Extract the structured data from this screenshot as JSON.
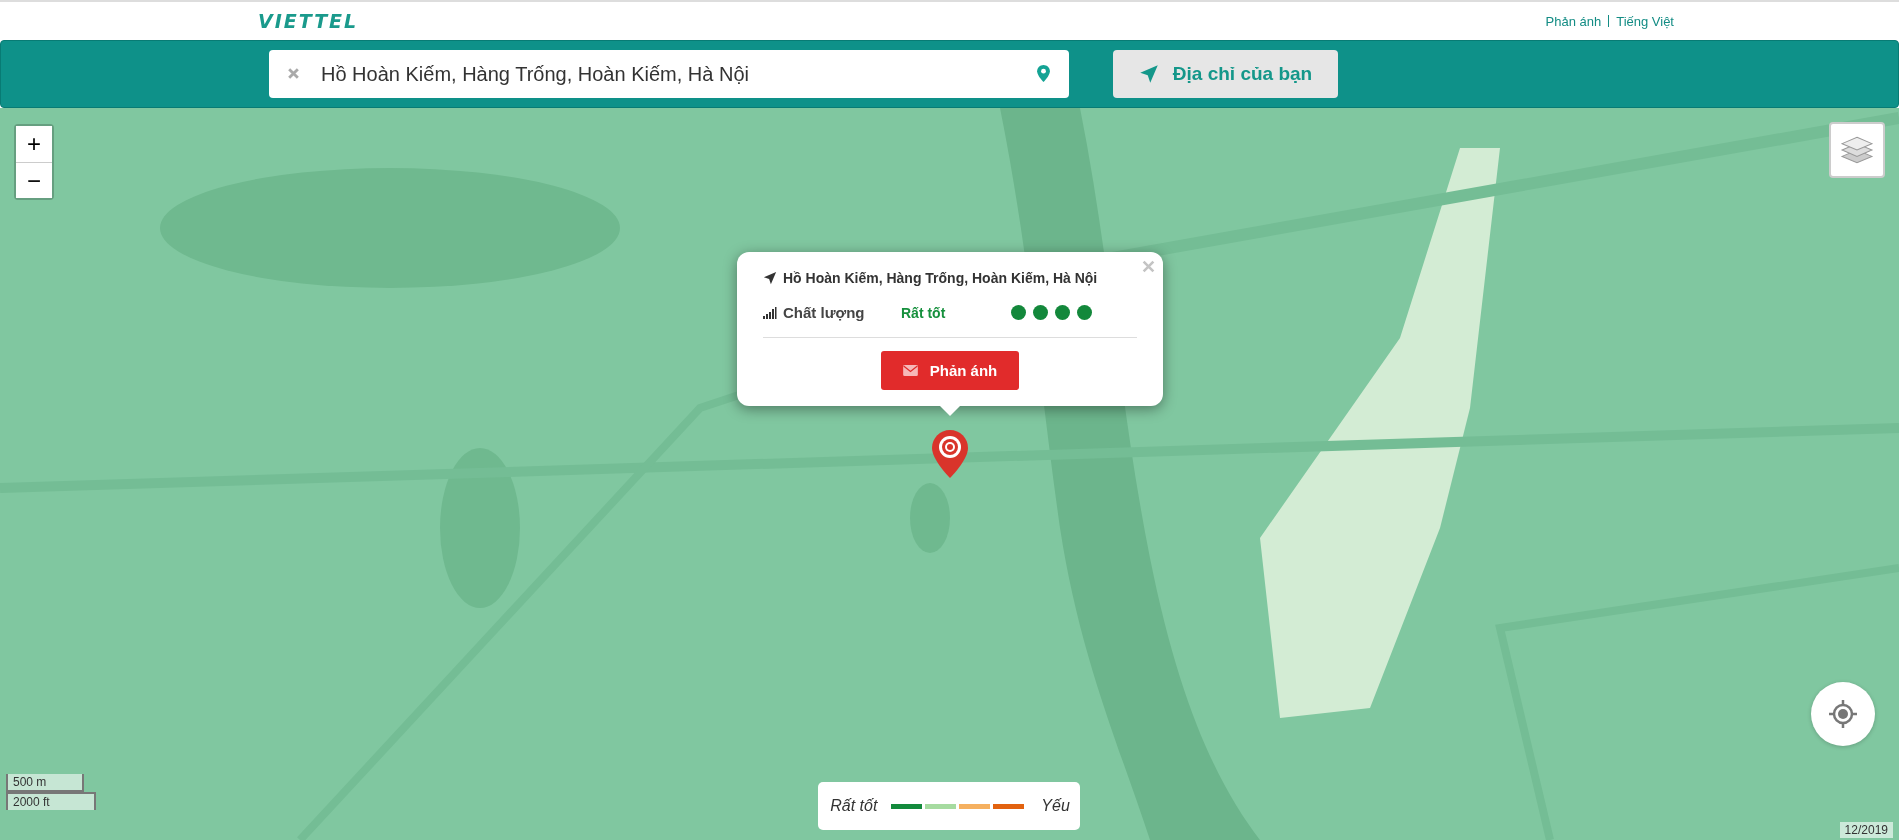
{
  "header": {
    "logo": "VIETTEL",
    "links": [
      {
        "label": "Phản ánh"
      },
      {
        "label": "Tiếng Việt"
      }
    ]
  },
  "search": {
    "value": "Hồ Hoàn Kiếm, Hàng Trống, Hoàn Kiếm, Hà Nội",
    "locate_button": "Địa chỉ của bạn"
  },
  "map": {
    "zoom_in": "+",
    "zoom_out": "−",
    "scale": [
      "500 m",
      "2000 ft"
    ],
    "date": "12/2019"
  },
  "popup": {
    "address": "Hồ Hoàn Kiếm, Hàng Trống, Hoàn Kiếm, Hà Nội",
    "quality_label": "Chất lượng",
    "quality_value": "Rất tốt",
    "stars": 4,
    "button": "Phản ánh"
  },
  "legend": {
    "left": "Rất tốt",
    "right": "Yếu",
    "swatches": [
      {
        "color": "#138a3c"
      },
      {
        "color": "#a6dba0"
      },
      {
        "color": "#f5b060"
      },
      {
        "color": "#e2620f"
      }
    ]
  }
}
